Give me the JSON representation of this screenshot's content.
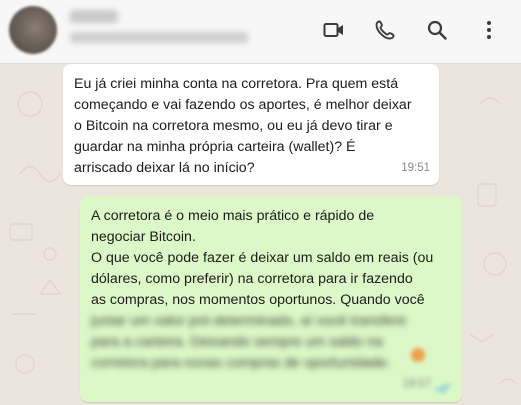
{
  "header": {
    "contact_name": "",
    "contact_status": "",
    "icons": [
      "video-call-icon",
      "phone-call-icon",
      "search-icon",
      "more-options-icon"
    ]
  },
  "messages": [
    {
      "direction": "incoming",
      "text": "Eu já criei minha conta na corretora. Pra quem está\ncomeçando e vai fazendo os aportes, é melhor deixar\no Bitcoin na corretora mesmo, ou eu já devo tirar e\nguardar na minha própria carteira (wallet)? É\narriscado deixar lá no início?",
      "time": "19:51"
    },
    {
      "direction": "outgoing",
      "text": "A corretora é o meio mais prático e rápido de\nnegociar Bitcoin.\nO que você pode fazer é deixar um saldo em reais (ou\ndólares, como preferir) na corretora para ir fazendo\nas compras, nos momentos oportunos. Quando você",
      "blurred_text": "juntar um valor pré-determinado, aí você transfere\npara a carteira. Deixando sempre um saldo na\ncorretora para novas compras de oportunidade.",
      "time": "19:57"
    }
  ],
  "colors": {
    "chat_background": "#ece5dd",
    "incoming_bubble": "#ffffff",
    "outgoing_bubble": "#dcf8c6",
    "header_background": "#f7f7f7",
    "icon_color": "#3b3b3b"
  }
}
